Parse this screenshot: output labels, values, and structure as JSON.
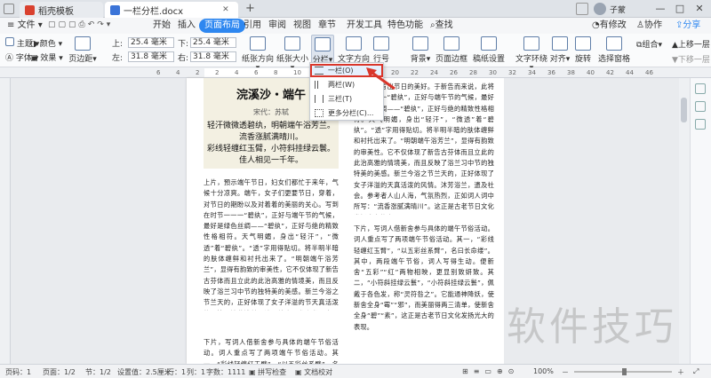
{
  "tabs": [
    {
      "label": "稻壳模板",
      "icon_color": "#d9412f"
    },
    {
      "label": "一栏分栏.docx",
      "icon_color": "#3b74d8"
    }
  ],
  "new_tab": "+",
  "window_controls": [
    "□",
    "—",
    "□",
    "✕"
  ],
  "menu": {
    "file": "文件",
    "items": [
      "开始",
      "插入",
      "页面布局",
      "引用",
      "审阅",
      "视图",
      "章节",
      "开发工具",
      "特色功能"
    ],
    "selected": "页面布局",
    "search": "查找",
    "right": [
      "有修改",
      "协作",
      "分享"
    ]
  },
  "ribbon": {
    "theme": "主题",
    "colors": "颜色",
    "font": "字体",
    "effects": "效果",
    "margins": "页边距",
    "top_label": "上:",
    "top_value": "25.4 毫米",
    "bottom_label": "下:",
    "bottom_value": "25.4 毫米",
    "left_label": "左:",
    "left_value": "31.8 毫米",
    "right_label": "右:",
    "right_value": "31.8 毫米",
    "orientation": "纸张方向",
    "size": "纸张大小",
    "columns": "分栏",
    "text_direction": "文字方向",
    "line_numbers": "行号",
    "background": "背景",
    "page_border": "页面边框",
    "draft_paper": "稿纸设置",
    "wrap": "文字环绕",
    "align": "对齐",
    "rotate": "旋转",
    "select_pane": "选择窗格",
    "group": "组合",
    "up_one": "上移一层",
    "down_one": "下移一层"
  },
  "ruler_ticks": [
    "6",
    "4",
    "2",
    "2",
    "4",
    "6",
    "8",
    "10",
    "12",
    "14",
    "16",
    "18",
    "20",
    "22",
    "24",
    "26",
    "28",
    "30",
    "32",
    "34",
    "36",
    "38",
    "40",
    "42",
    "44",
    "46"
  ],
  "dropdown": {
    "items": [
      "一栏(O)",
      "两栏(W)",
      "三栏(T)",
      "更多分栏(C)..."
    ],
    "highlighted": 0
  },
  "document": {
    "title": "浣溪沙・端午",
    "author": "宋代：苏轼",
    "poem": [
      "轻汗微微透碧纨，明朝端午浴芳兰。流香涨腻满晴川。",
      "彩线轻缠红玉臂，小符斜挂绿云鬟。佳人相见一千年。"
    ],
    "col1": "上片，預示端午节日，妇女们都忙于来年，气候十分凉爽。端午，女子们更要节日，穿着，对节日的期盼以及对着着的美丽的关心。写到在时节一一一“碧纨”，正好与端午节的气候，最好是绿色丝绸——“碧纨”，正好与绝的精致性格相符。天气明媚，身出“轻汗”，“微透”着“碧纨”。“透”字用得贴切。将半明半暗的肤体缠鲜和衬托出来了。“明朝端午浴芳兰”，显得有韵致的审美性，它不仅体现了新告古芬体而且立此的此治高雅的情境美，而且反映了浴兰习中节的独特美的美感。新兰今浴之节兰天的，正好体现了女子洋溢的节天真活泼的风情。沐芳浴兰，遗及社会。参考者人山人海，气氛热烈，正如词人词中所写：“流香涨腻满晴川”。这正是古老节日文化发扬光大的表现。",
    "col1b": "下片，写词人借新舍参与具体的端午节俗活动。词人重点写了两项端午节俗活动。其一，“彩线轻缠红玉臂”，“以五彩丝系臂”，名曰长命缕”。",
    "col2a": "的衬托来写出节日的美好。于新告而来说，此将重点地一一“碧纨”，正好与端午节的气候，最好是绿色丝绸——“碧纨”，正好与绝的精致性格相符。天气明媚，身出“轻汗”，“微透”着“碧纨”。“透”字用得贴切。将半明半暗的肤体缠鲜和衬托出来了。“明朝端午浴芳兰”，显得有韵致的审美性。它不仅体现了新告古芬体而且立此的此治高雅的情境美，而且反映了浴兰习中节的独特美的美感。新兰今浴之节兰天的，正好体现了女子洋溢的天真活泼的风情。沐芳浴兰，遗及社会。参考者人山人海，气氛热烈，正如词人词中所写：“流香涨腻满晴川”。这正是古老节日文化发扬光大的表现。",
    "col2b": "下片，写词人借新舍参与具体的端午节俗活动。词人重点写了两项端午节俗活动。其一，“彩线轻缠红玉臂”，“以五彩丝系臂”，名曰长命缕”。其中，两段端午节俗，词人写得生动。便新舍“五彩”“红”两物相映，更显别致妍致。其二，“小符斜挂绿云鬟”，“小符斜挂绿云鬟”，佩戴于各色发，称“灵符咎之”。它能通神降妖，使新舍全身“霉”“邪”，而美丽得两三清单，使新舍全身“碧”“素”，这正是古老节日文化发扬光大的表现。"
  },
  "status": {
    "page": "页码：1",
    "pages": "页面：1/2",
    "section": "节：1/2",
    "setting": "设置值：2.5厘米",
    "row": "行：1",
    "col": "列：1",
    "wordcount": "字数：1111",
    "spell": "拼写检查",
    "proof": "文档校对",
    "zoom": "100%"
  },
  "watermark": "软件技巧",
  "colors": {
    "accent": "#2e87f0",
    "arrow": "#d9362b",
    "dropdown_border": "#d9362b"
  }
}
